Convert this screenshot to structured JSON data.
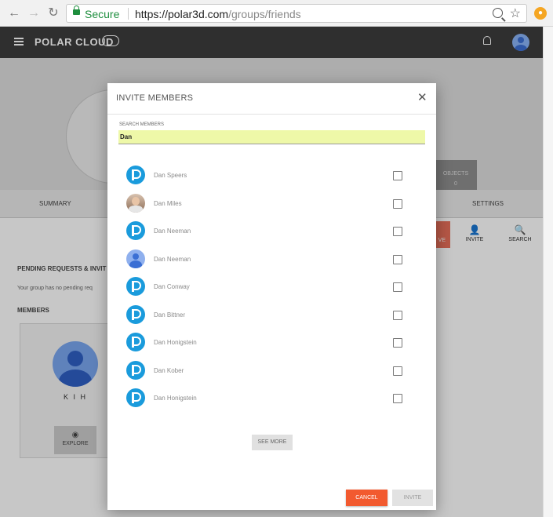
{
  "browser": {
    "secure_label": "Secure",
    "url_host": "https://polar3d.com",
    "url_path": "/groups/friends",
    "back_glyph": "←",
    "forward_glyph": "→",
    "reload_glyph": "↻",
    "star_glyph": "☆",
    "extension_glyph": "●"
  },
  "app": {
    "brand": "POLAR CLOUD",
    "tabs": {
      "summary": "SUMMARY",
      "settings": "SETTINGS"
    },
    "objects_label": "OBJECTS",
    "objects_count": "0",
    "actions": {
      "leave": "VE",
      "invite": "INVITE",
      "search": "SEARCH",
      "invite_glyph": "👤",
      "search_glyph": "🔍"
    },
    "pending_title": "PENDING REQUESTS & INVIT",
    "pending_text": "Your group has no pending req",
    "members_title": "MEMBERS",
    "member_name": "K I H",
    "explore_label": "EXPLORE",
    "explore_glyph": "◉",
    "accent_color": "#f25a2f"
  },
  "modal": {
    "title": "INVITE MEMBERS",
    "close_glyph": "✕",
    "search_label": "SEARCH MEMBERS",
    "search_value": "Dan",
    "results": [
      {
        "name": "Dan Speers",
        "avatar": "polar-logo",
        "checked": false
      },
      {
        "name": "Dan Miles",
        "avatar": "photo",
        "checked": false
      },
      {
        "name": "Dan Neeman",
        "avatar": "polar-logo",
        "checked": false
      },
      {
        "name": "Dan Neeman",
        "avatar": "default-user",
        "checked": false
      },
      {
        "name": "Dan Conway",
        "avatar": "polar-logo",
        "checked": false
      },
      {
        "name": "Dan Bittner",
        "avatar": "polar-logo",
        "checked": false
      },
      {
        "name": "Dan Honigstein",
        "avatar": "polar-logo",
        "checked": false
      },
      {
        "name": "Dan Kober",
        "avatar": "polar-logo",
        "checked": false
      },
      {
        "name": "Dan Honigstein",
        "avatar": "polar-logo",
        "checked": false
      }
    ],
    "see_more_label": "SEE MORE",
    "cancel_label": "CANCEL",
    "invite_label": "INVITE"
  }
}
